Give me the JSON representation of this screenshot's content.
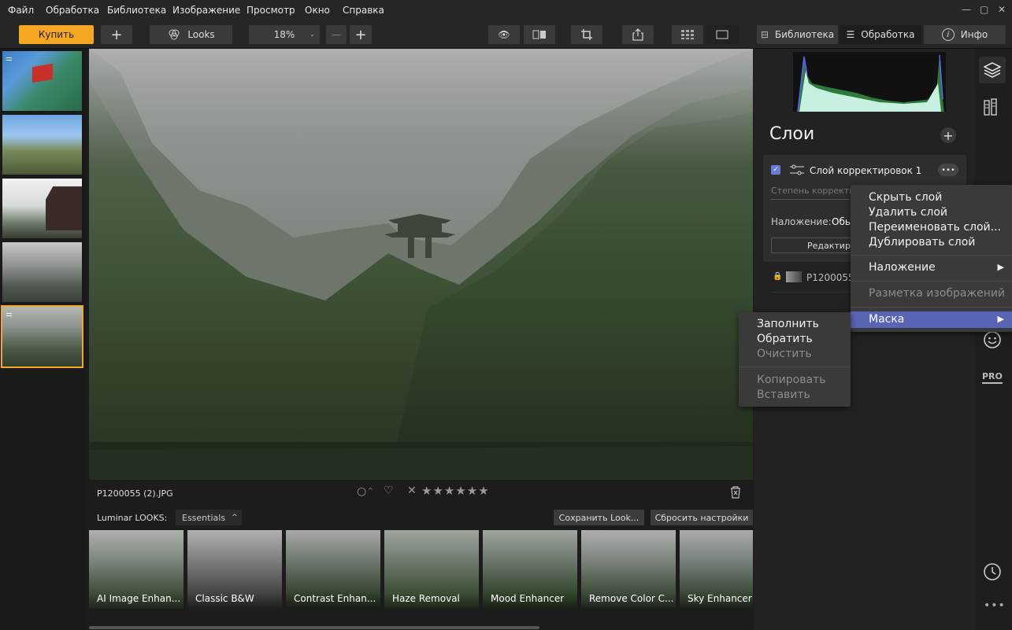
{
  "menubar": {
    "items": [
      "Файл",
      "Обработка",
      "Библиотека",
      "Изображение",
      "Просмотр",
      "Окно",
      "Справка"
    ],
    "window_controls": [
      "minimize-icon",
      "maximize-icon",
      "close-icon"
    ]
  },
  "toolbar": {
    "buy_label": "Купить",
    "looks_label": "Looks",
    "zoom_value": "18%",
    "tabs": [
      {
        "label": "Библиотека",
        "icon": "library-icon"
      },
      {
        "label": "Обработка",
        "icon": "sliders-icon",
        "active": true
      },
      {
        "label": "Инфо",
        "icon": "info-icon"
      }
    ]
  },
  "info": {
    "filename": "P1200055 (2).JPG",
    "rating_stars": 0
  },
  "looks": {
    "label": "Luminar LOOKS:",
    "category": "Essentials",
    "save_label": "Сохранить Look...",
    "reset_label": "Сбросить настройки",
    "items": [
      "AI Image Enhan...",
      "Classic B&W",
      "Contrast Enhan...",
      "Haze Removal",
      "Mood Enhancer",
      "Remove Color C...",
      "Sky Enhancer"
    ]
  },
  "layers": {
    "title": "Слои",
    "layer_name": "Слой корректировок 1",
    "opacity_label": "Степень корректи",
    "blend_label": "Наложение:",
    "blend_value": "Обы",
    "edit_label": "Редактир",
    "base_layer": "P1200055"
  },
  "context_menu": {
    "items": [
      "Скрыть слой",
      "Удалить слой",
      "Переименовать слой...",
      "Дублировать слой"
    ],
    "blend": "Наложение",
    "markup": "Разметка изображений",
    "mask": "Маска"
  },
  "submenu": {
    "fill": "Заполнить",
    "invert": "Обратить",
    "clear": "Очистить",
    "copy": "Копировать",
    "paste": "Вставить"
  },
  "colors": {
    "accent": "#f5a623",
    "highlight": "#5a64b4"
  }
}
